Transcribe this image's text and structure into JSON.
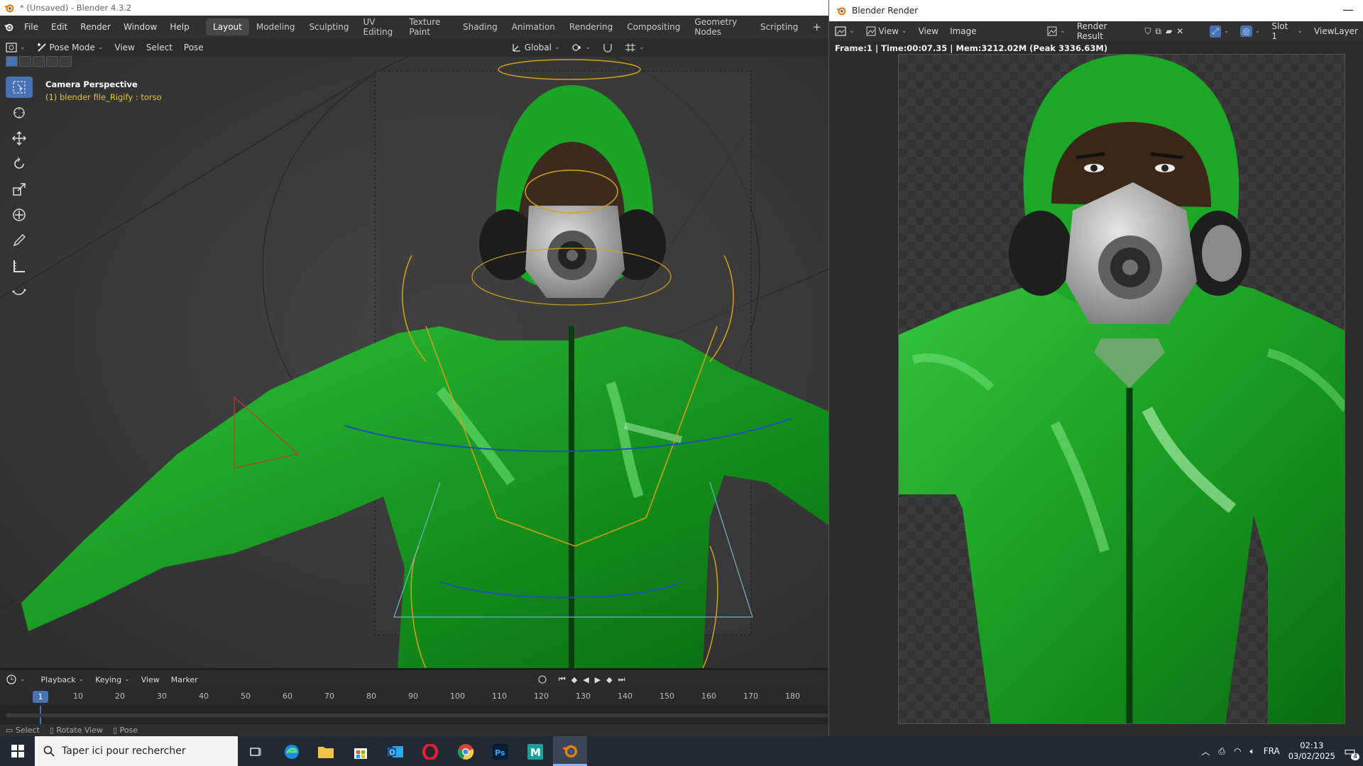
{
  "main_window": {
    "title": "* (Unsaved) - Blender 4.3.2"
  },
  "menubar": {
    "menus": [
      "File",
      "Edit",
      "Render",
      "Window",
      "Help"
    ],
    "workspaces": [
      "Layout",
      "Modeling",
      "Sculpting",
      "UV Editing",
      "Texture Paint",
      "Shading",
      "Animation",
      "Rendering",
      "Compositing",
      "Geometry Nodes",
      "Scripting"
    ],
    "active_workspace": "Layout",
    "add_tab": "+"
  },
  "viewport_header": {
    "mode": "Pose Mode",
    "menus": [
      "View",
      "Select",
      "Pose"
    ],
    "orientation": "Global"
  },
  "viewport": {
    "camera_label": "Camera Perspective",
    "active_object": "(1) blender file_Rigify : torso"
  },
  "timeline": {
    "menus": [
      "Playback",
      "Keying",
      "View",
      "Marker"
    ],
    "current_frame": "1",
    "ticks": [
      "10",
      "20",
      "30",
      "40",
      "50",
      "60",
      "70",
      "80",
      "90",
      "100",
      "110",
      "120",
      "130",
      "140",
      "150",
      "160",
      "170",
      "180"
    ]
  },
  "statusbar": {
    "items": [
      "Select",
      "Rotate View",
      "Pose"
    ]
  },
  "render_window": {
    "title": "Blender Render",
    "menus": [
      "View",
      "View",
      "Image"
    ],
    "image_name": "Render Result",
    "slot": "Slot 1",
    "view_layer": "ViewLayer",
    "info": "Frame:1 | Time:00:07.35 | Mem:3212.02M (Peak 3336.63M)"
  },
  "taskbar": {
    "search_placeholder": "Taper ici pour rechercher",
    "language": "FRA",
    "time": "02:13",
    "date": "03/02/2025",
    "notification_count": "4"
  },
  "colors": {
    "blender_orange": "#e87d0d",
    "active_blue": "#4772b3",
    "suit_green": "#1fa31f",
    "bone_yellow": "#d4a017"
  }
}
